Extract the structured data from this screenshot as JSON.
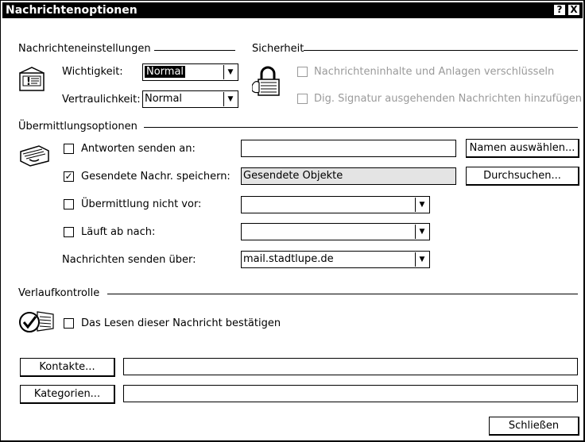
{
  "window": {
    "title": "Nachrichtenoptionen",
    "help_label": "?",
    "close_label": "X"
  },
  "message_settings": {
    "section_label": "Nachrichteneinstellungen",
    "importance_label": "Wichtigkeit:",
    "importance_value": "Normal",
    "sensitivity_label": "Vertraulichkeit:",
    "sensitivity_value": "Normal"
  },
  "security": {
    "section_label": "Sicherheit",
    "encrypt_label": "Nachrichteninhalte und Anlagen verschlüsseln",
    "encrypt_checked": false,
    "sign_label": "Dig. Signatur ausgehenden Nachrichten hinzufügen",
    "sign_checked": false
  },
  "delivery": {
    "section_label": "Übermittlungsoptionen",
    "reply_to_label": "Antworten senden an:",
    "reply_to_value": "",
    "reply_to_checked": false,
    "select_names_button": "Namen auswählen...",
    "save_sent_label": "Gesendete Nachr. speichern:",
    "save_sent_value": "Gesendete Objekte",
    "save_sent_checked": true,
    "browse_button": "Durchsuchen...",
    "do_not_deliver_label": "Übermittlung nicht vor:",
    "do_not_deliver_value": "",
    "do_not_deliver_checked": false,
    "expires_label": "Läuft ab nach:",
    "expires_value": "",
    "expires_checked": false,
    "send_via_label": "Nachrichten senden über:",
    "send_via_value": "mail.stadtlupe.de"
  },
  "tracking": {
    "section_label": "Verlaufkontrolle",
    "read_receipt_label": "Das Lesen dieser Nachricht bestätigen",
    "read_receipt_checked": false
  },
  "contacts_button": "Kontakte...",
  "contacts_value": "",
  "categories_button": "Kategorien...",
  "categories_value": "",
  "close_button": "Schließen",
  "icons": {
    "envelope": "envelope-importance-icon",
    "padlock": "padlock-icon",
    "delivery_hand": "delivery-hand-icon",
    "read_check": "read-receipt-check-icon"
  }
}
